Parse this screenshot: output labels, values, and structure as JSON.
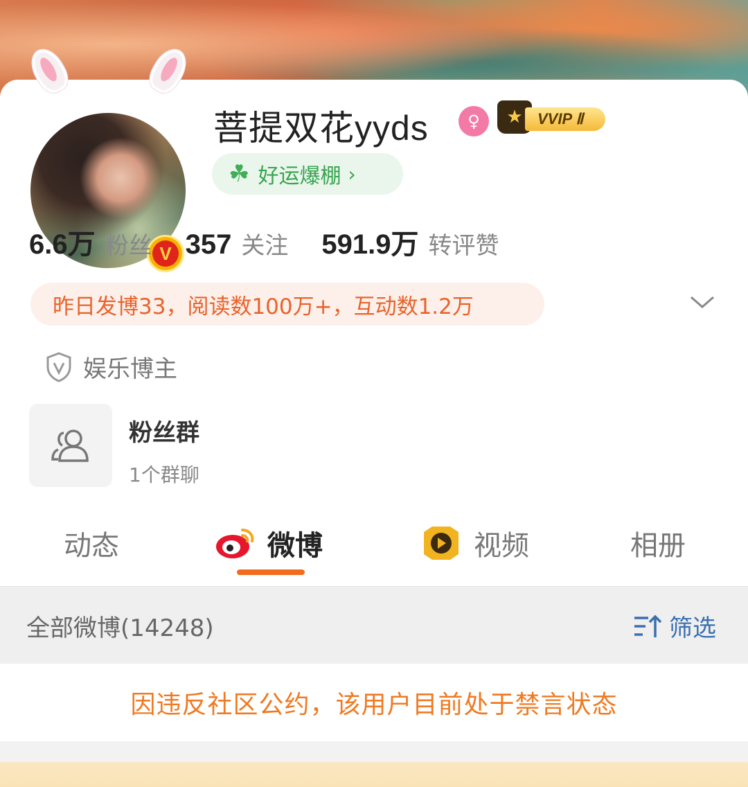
{
  "profile": {
    "name": "菩提双花yyds",
    "gender_icon": "female-icon",
    "vip_label": "VVIP Ⅱ",
    "luck_label": "好运爆棚",
    "verified_badge": "V"
  },
  "stats": [
    {
      "num": "6.6万",
      "label": "粉丝"
    },
    {
      "num": "357",
      "label": "关注"
    },
    {
      "num": "591.9万",
      "label": "转评赞"
    }
  ],
  "summary": "昨日发博33，阅读数100万+，互动数1.2万",
  "tag": "娱乐博主",
  "fan_group": {
    "title": "粉丝群",
    "subtitle": "1个群聊"
  },
  "tabs": [
    {
      "label": "动态",
      "icon": ""
    },
    {
      "label": "微博",
      "icon": "weibo-icon"
    },
    {
      "label": "视频",
      "icon": "video-icon"
    },
    {
      "label": "相册",
      "icon": ""
    }
  ],
  "filter_bar": {
    "all_label": "全部微博(14248)",
    "filter_label": "筛选"
  },
  "notice": "因违反社区公约，该用户目前处于禁言状态",
  "colors": {
    "accent": "#f26b1d",
    "notice": "#ef7a22",
    "summary_text": "#e8632c",
    "link": "#3a6fb0"
  }
}
